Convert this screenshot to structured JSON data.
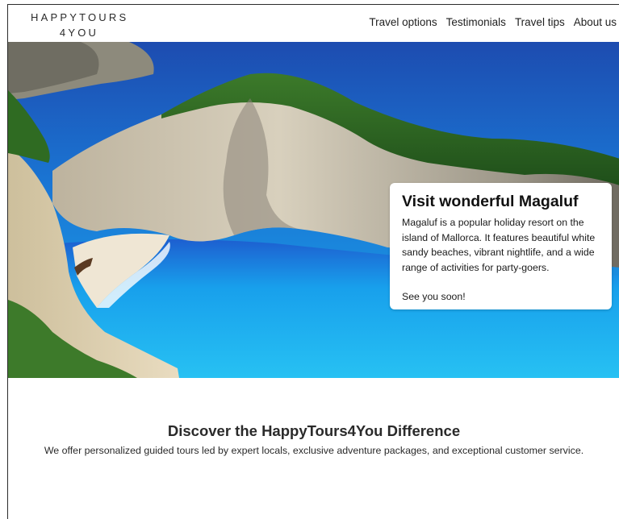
{
  "brand": {
    "line1": "HAPPYTOURS",
    "line2": "4YOU"
  },
  "nav": {
    "items": [
      {
        "label": "Travel options"
      },
      {
        "label": "Testimonials"
      },
      {
        "label": "Travel tips"
      },
      {
        "label": "About us"
      }
    ]
  },
  "hero": {
    "image_subject": "aerial view of a cove with a white sand beach, limestone cliffs and turquoise sea",
    "card": {
      "title": "Visit wonderful Magaluf",
      "body": "Magaluf is a popular holiday resort on the island of Mallorca. It features beautiful white sandy beaches, vibrant nightlife, and a wide range of activities for party-goers.",
      "signoff": "See you soon!"
    }
  },
  "discover": {
    "title": "Discover the HappyTours4You Difference",
    "text": "We offer personalized guided tours led by expert locals, exclusive adventure packages, and exceptional customer service."
  },
  "colors": {
    "sea_deep": "#1f4fb0",
    "sea_bright": "#18b6ee",
    "cliff": "#d9cdb5",
    "vegetation": "#2f6b22",
    "text_dark": "#1f1f1f"
  }
}
